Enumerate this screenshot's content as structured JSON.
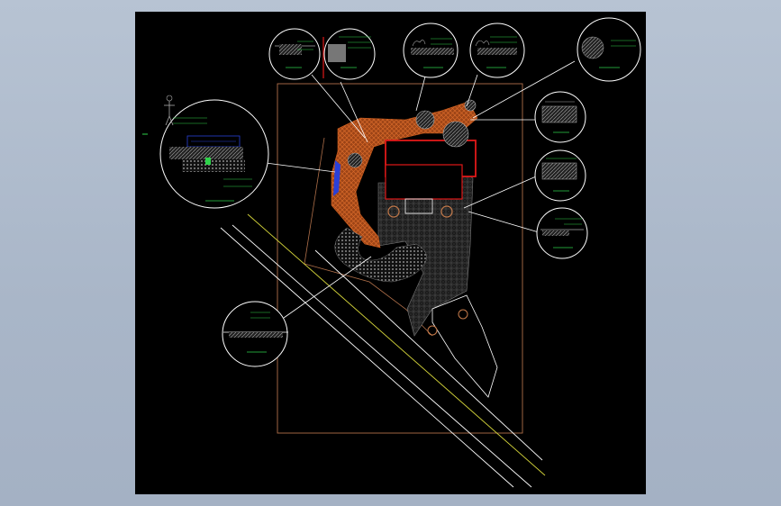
{
  "drawing": {
    "background": "#000000",
    "viewport_background": "#acb9cb",
    "colors": {
      "site_boundary": "#b0704a",
      "building_outline": "#e01818",
      "paving_brown": "#b8521c",
      "paving_grey": "#6a6a6a",
      "road_white": "#ffffff",
      "road_yellow": "#d4d43a",
      "detail_circle": "#ffffff",
      "leader": "#ffffff",
      "annotation_green": "#2ed24a",
      "water_blue": "#2a40d8"
    },
    "callouts": [
      {
        "id": "detail-top-left-1",
        "icon": "paving-section-detail"
      },
      {
        "id": "detail-top-left-2",
        "icon": "tile-swatch-detail"
      },
      {
        "id": "detail-top-mid-1",
        "icon": "planter-section-detail"
      },
      {
        "id": "detail-top-mid-2",
        "icon": "planter-section-detail"
      },
      {
        "id": "detail-top-right",
        "icon": "tree-pit-detail"
      },
      {
        "id": "detail-right-1",
        "icon": "hatch-swatch-detail"
      },
      {
        "id": "detail-right-2",
        "icon": "hatch-swatch-detail"
      },
      {
        "id": "detail-right-3",
        "icon": "layer-section-detail"
      },
      {
        "id": "detail-left-large",
        "icon": "pond-section-detail"
      },
      {
        "id": "detail-bottom-left",
        "icon": "curb-section-detail"
      }
    ]
  }
}
